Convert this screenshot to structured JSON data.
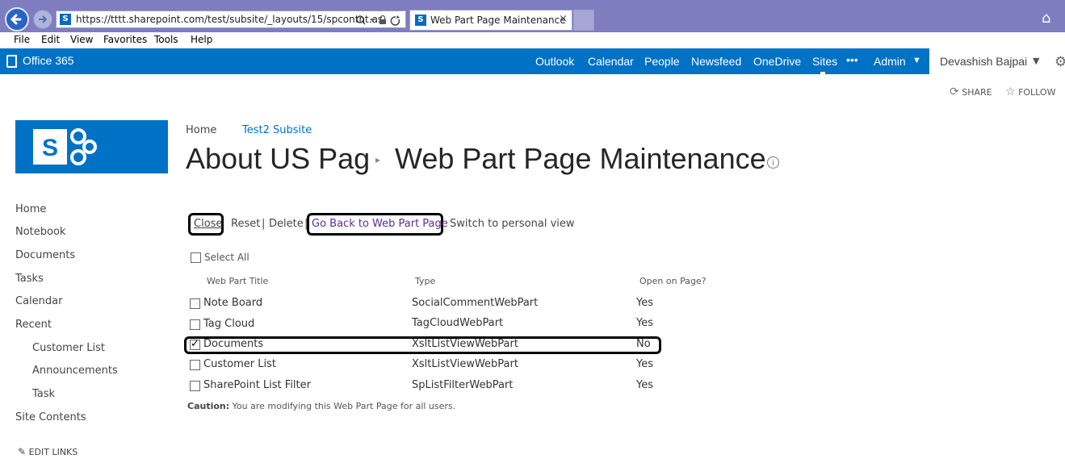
{
  "browser": {
    "url": "https://tttt.sharepoint.com/test/subsite/_layouts/15/spcontnt.as",
    "tab_title": "Web Part Page Maintenance",
    "tab_close": "×",
    "menu": [
      "File",
      "Edit",
      "View",
      "Favorites",
      "Tools",
      "Help"
    ]
  },
  "suite": {
    "brand": "Office 365",
    "links": [
      "Outlook",
      "Calendar",
      "People",
      "Newsfeed",
      "OneDrive",
      "Sites",
      "•••",
      "Admin"
    ],
    "user": "Devashish Bajpai",
    "accent": "#0072c6"
  },
  "actions": {
    "share": "SHARE",
    "follow": "FOLLOW"
  },
  "breadcrumb": {
    "home": "Home",
    "subsite": "Test2 Subsite"
  },
  "title": {
    "part1": "About US Pag",
    "part2": "Web Part Page Maintenance"
  },
  "nav": {
    "items": [
      "Home",
      "Notebook",
      "Documents",
      "Tasks",
      "Calendar",
      "Recent"
    ],
    "recent": [
      "Customer List",
      "Announcements",
      "Task"
    ],
    "site_contents": "Site Contents",
    "edit_links": "EDIT LINKS"
  },
  "toolbar": {
    "close": "Close",
    "reset": "Reset",
    "sep": "|",
    "delete": "Delete",
    "go_back": "Go Back to Web Part Page",
    "switch": "Switch to personal view"
  },
  "table": {
    "select_all": "Select All",
    "headers": [
      "Web Part Title",
      "Type",
      "Open on Page?"
    ],
    "rows": [
      {
        "title": "Note Board",
        "type": "SocialCommentWebPart",
        "open": "Yes",
        "checked": false
      },
      {
        "title": "Tag Cloud",
        "type": "TagCloudWebPart",
        "open": "Yes",
        "checked": false
      },
      {
        "title": "Documents",
        "type": "XsltListViewWebPart",
        "open": "No",
        "checked": true
      },
      {
        "title": "Customer List",
        "type": "XsltListViewWebPart",
        "open": "Yes",
        "checked": false
      },
      {
        "title": "SharePoint List Filter",
        "type": "SpListFilterWebPart",
        "open": "Yes",
        "checked": false
      }
    ]
  },
  "caution": {
    "label": "Caution:",
    "text": " You are modifying this Web Part Page for all users."
  }
}
